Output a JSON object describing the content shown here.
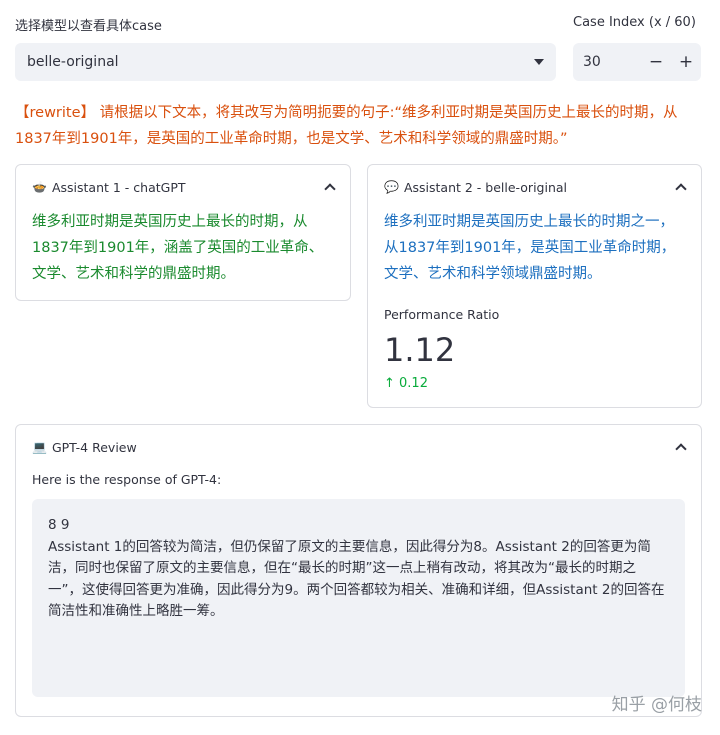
{
  "model_select": {
    "label": "选择模型以查看具体case",
    "value": "belle-original"
  },
  "case_index": {
    "label": "Case Index (x / 60)",
    "value": "30",
    "minus": "−",
    "plus": "+"
  },
  "prompt_text": "【rewrite】 请根据以下文本，将其改写为简明扼要的句子:“维多利亚时期是英国历史上最长的时期，从1837年到1901年，是英国的工业革命时期，也是文学、艺术和科学领域的鼎盛时期。”",
  "assistant1": {
    "icon": "🍲",
    "title": "Assistant 1 - chatGPT",
    "text": "维多利亚时期是英国历史上最长的时期，从1837年到1901年，涵盖了英国的工业革命、文学、艺术和科学的鼎盛时期。",
    "color": "#1a8a2e"
  },
  "assistant2": {
    "icon": "💬",
    "title": "Assistant 2 - belle-original",
    "text": "维多利亚时期是英国历史上最长的时期之一，从1837年到1901年，是英国工业革命时期，文学、艺术和科学领域鼎盛时期。",
    "color": "#1c6fbf"
  },
  "metric": {
    "label": "Performance Ratio",
    "value": "1.12",
    "delta": "↑ 0.12"
  },
  "review": {
    "icon": "💻",
    "title": "GPT-4 Review",
    "intro": "Here is the response of GPT-4:",
    "scores": "8 9",
    "text": "Assistant 1的回答较为简洁，但仍保留了原文的主要信息，因此得分为8。Assistant 2的回答更为简洁，同时也保留了原文的主要信息，但在“最长的时期”这一点上稍有改动，将其改为“最长的时期之一”，这使得回答更为准确，因此得分为9。两个回答都较为相关、准确和详细，但Assistant 2的回答在简洁性和准确性上略胜一筹。"
  },
  "watermark": "知乎 @何枝"
}
